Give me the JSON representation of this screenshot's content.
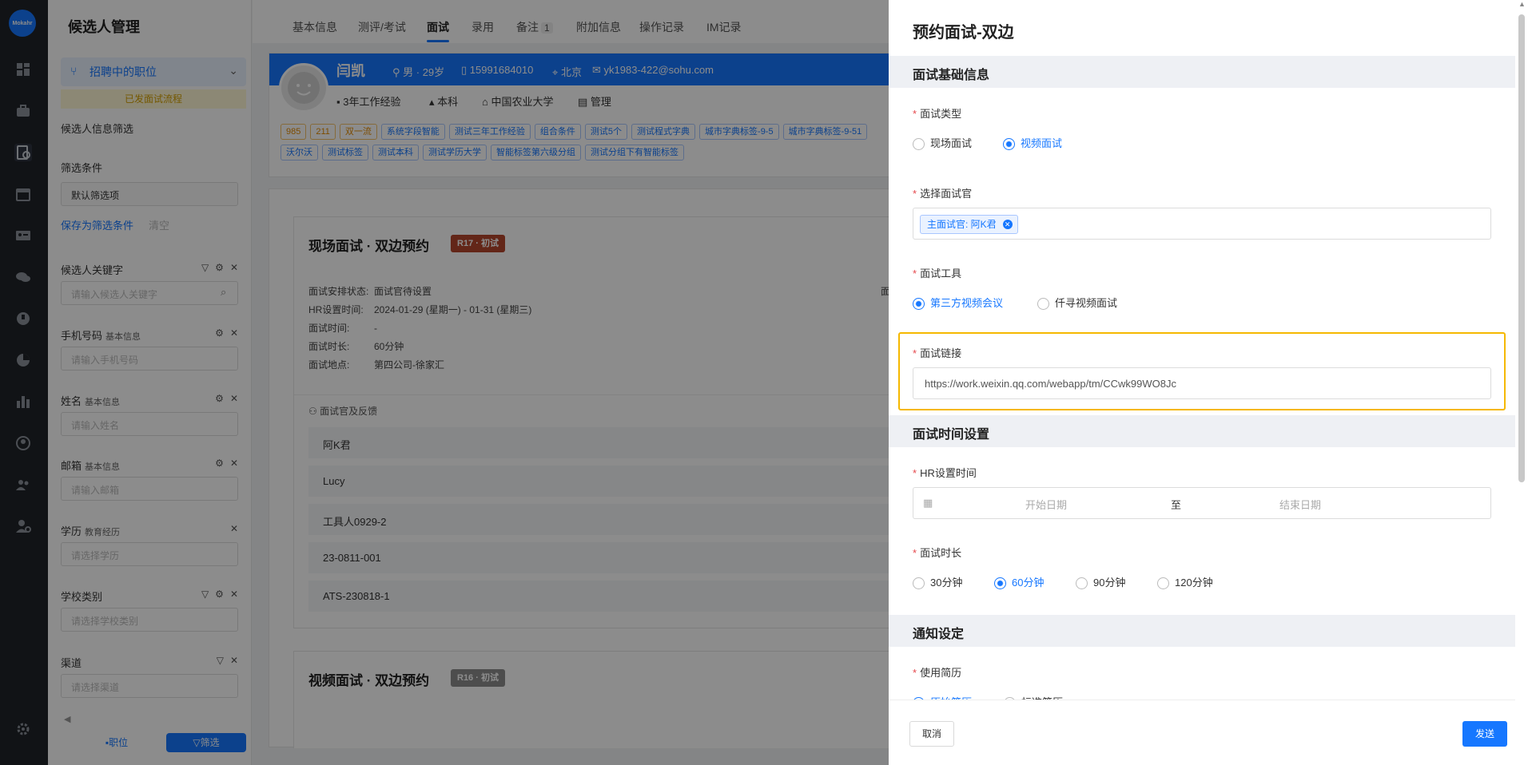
{
  "rail": {
    "logo_text": "Mokahr",
    "icons": [
      "dashboard-icon",
      "briefcase-icon",
      "candidate-icon",
      "calendar-icon",
      "id-card-icon",
      "chat-icon",
      "talent-icon",
      "pie-icon",
      "bar-chart-icon",
      "portrait-icon",
      "team-icon",
      "user-settings-icon",
      "settings-icon"
    ]
  },
  "panel": {
    "title": "候选人管理",
    "job_selector": "招聘中的职位",
    "banner": "已发面试流程",
    "info_filter": "候选人信息筛选",
    "filter_conditions": "筛选条件",
    "default_filter": "默认筛选项",
    "save_filter": "保存为筛选条件",
    "clear": "清空",
    "fields": [
      {
        "label": "候选人关键字",
        "sub": "",
        "placeholder": "请输入候选人关键字"
      },
      {
        "label": "手机号码",
        "sub": "基本信息",
        "placeholder": "请输入手机号码"
      },
      {
        "label": "姓名",
        "sub": "基本信息",
        "placeholder": "请输入姓名"
      },
      {
        "label": "邮箱",
        "sub": "基本信息",
        "placeholder": "请输入邮箱"
      },
      {
        "label": "学历",
        "sub": "教育经历",
        "placeholder": "请选择学历"
      },
      {
        "label": "学校类别",
        "sub": "",
        "placeholder": "请选择学校类别"
      },
      {
        "label": "渠道",
        "sub": "",
        "placeholder": "请选择渠道"
      }
    ],
    "bottom_job": "职位",
    "bottom_filter": "筛选"
  },
  "tabs": [
    {
      "label": "基本信息"
    },
    {
      "label": "测评/考试"
    },
    {
      "label": "面试"
    },
    {
      "label": "录用"
    },
    {
      "label": "备注",
      "count": "1"
    },
    {
      "label": "附加信息"
    },
    {
      "label": "操作记录"
    },
    {
      "label": "IM记录"
    }
  ],
  "candidate": {
    "name": "闫凯",
    "gender_age": "男 · 29岁",
    "phone": "15991684010",
    "city": "北京",
    "email": "yk1983-422@sohu.com",
    "experience": "3年工作经验",
    "degree": "本科",
    "school": "中国农业大学",
    "major": "管理",
    "tags_row1": [
      "985",
      "211",
      "双一流",
      "系统字段智能",
      "测试三年工作经验",
      "组合条件",
      "测试5个",
      "测试程式字典",
      "城市字典标签-9-5",
      "城市字典标签-9-51"
    ],
    "tags_row2": [
      "沃尔沃",
      "测试标签",
      "测试本科",
      "测试学历大学",
      "智能标签第六级分组",
      "测试分组下有智能标签"
    ]
  },
  "interview1": {
    "title": "现场面试 · 双边预约",
    "badge": "R17 · 初试",
    "status_label": "面试安排状态:",
    "status_value": "面试官待设置",
    "hr_label": "HR设置时间:",
    "hr_value": "2024-01-29 (星期一) - 01-31 (星期三)",
    "time_label": "面试时间:",
    "time_value": "-",
    "duration_label": "面试时长:",
    "duration_value": "60分钟",
    "location_label": "面试地点:",
    "location_value": "第四公司-徐家汇",
    "right_label": "面",
    "feedback_label": "面试官及反馈",
    "interviewers": [
      "阿K君",
      "Lucy",
      "工具人0929-2",
      "23-0811-001",
      "ATS-230818-1"
    ]
  },
  "interview2": {
    "title": "视频面试 · 双边预约",
    "badge": "R16 · 初试"
  },
  "drawer": {
    "title": "预约面试-双边",
    "section_basic": "面试基础信息",
    "type_label": "面试类型",
    "type_options": [
      "现场面试",
      "视频面试"
    ],
    "type_selected": 1,
    "interviewer_label": "选择面试官",
    "interviewer_chip": "主面试官: 阿K君",
    "tool_label": "面试工具",
    "tool_options": [
      "第三方视频会议",
      "仟寻视频面试"
    ],
    "tool_selected": 0,
    "link_label": "面试链接",
    "link_value": "https://work.weixin.qq.com/webapp/tm/CCwk99WO8Jc",
    "section_time": "面试时间设置",
    "hr_time_label": "HR设置时间",
    "start_placeholder": "开始日期",
    "range_sep": "至",
    "end_placeholder": "结束日期",
    "duration_label": "面试时长",
    "duration_options": [
      "30分钟",
      "60分钟",
      "90分钟",
      "120分钟"
    ],
    "duration_selected": 1,
    "section_notify": "通知设定",
    "resume_label": "使用简历",
    "resume_options": [
      "原始简历",
      "标准简历"
    ],
    "cancel": "取消",
    "send": "发送"
  }
}
